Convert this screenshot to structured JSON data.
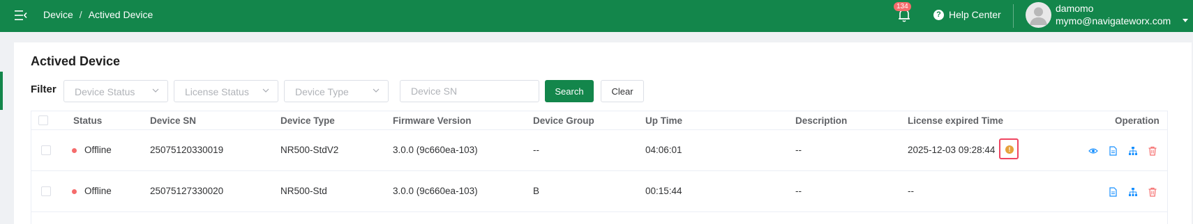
{
  "header": {
    "breadcrumb": [
      "Device",
      "/",
      "Actived Device"
    ],
    "notification_count": "134",
    "help_label": "Help Center",
    "user_name": "damomo",
    "user_email": "mymo@navigateworx.com",
    "brand_color": "#13864b"
  },
  "page": {
    "title": "Actived Device"
  },
  "filter": {
    "label": "Filter",
    "device_status_placeholder": "Device Status",
    "license_status_placeholder": "License Status",
    "device_type_placeholder": "Device Type",
    "device_sn_placeholder": "Device SN",
    "search_label": "Search",
    "clear_label": "Clear"
  },
  "table": {
    "columns": [
      "Status",
      "Device SN",
      "Device Type",
      "Firmware Version",
      "Device Group",
      "Up Time",
      "Description",
      "License expired Time",
      "Operation"
    ],
    "rows": [
      {
        "status": "Offline",
        "sn": "25075120330019",
        "type": "NR500-StdV2",
        "firmware": "3.0.0 (9c660ea-103)",
        "group": "--",
        "uptime": "04:06:01",
        "description": "--",
        "license_expired": "2025-12-03 09:28:44",
        "license_warning_icon": "warning-icon",
        "operations": [
          "view-icon",
          "document-icon",
          "topology-icon",
          "delete-icon"
        ]
      },
      {
        "status": "Offline",
        "sn": "25075127330020",
        "type": "NR500-Std",
        "firmware": "3.0.0 (9c660ea-103)",
        "group": "B",
        "uptime": "00:15:44",
        "description": "--",
        "license_expired": "--",
        "operations": [
          "document-icon",
          "topology-icon",
          "delete-icon"
        ]
      }
    ],
    "status_offline_color": "#f56c6c",
    "operation_icon_color": "#1890ff",
    "delete_icon_color": "#f56c6c"
  }
}
